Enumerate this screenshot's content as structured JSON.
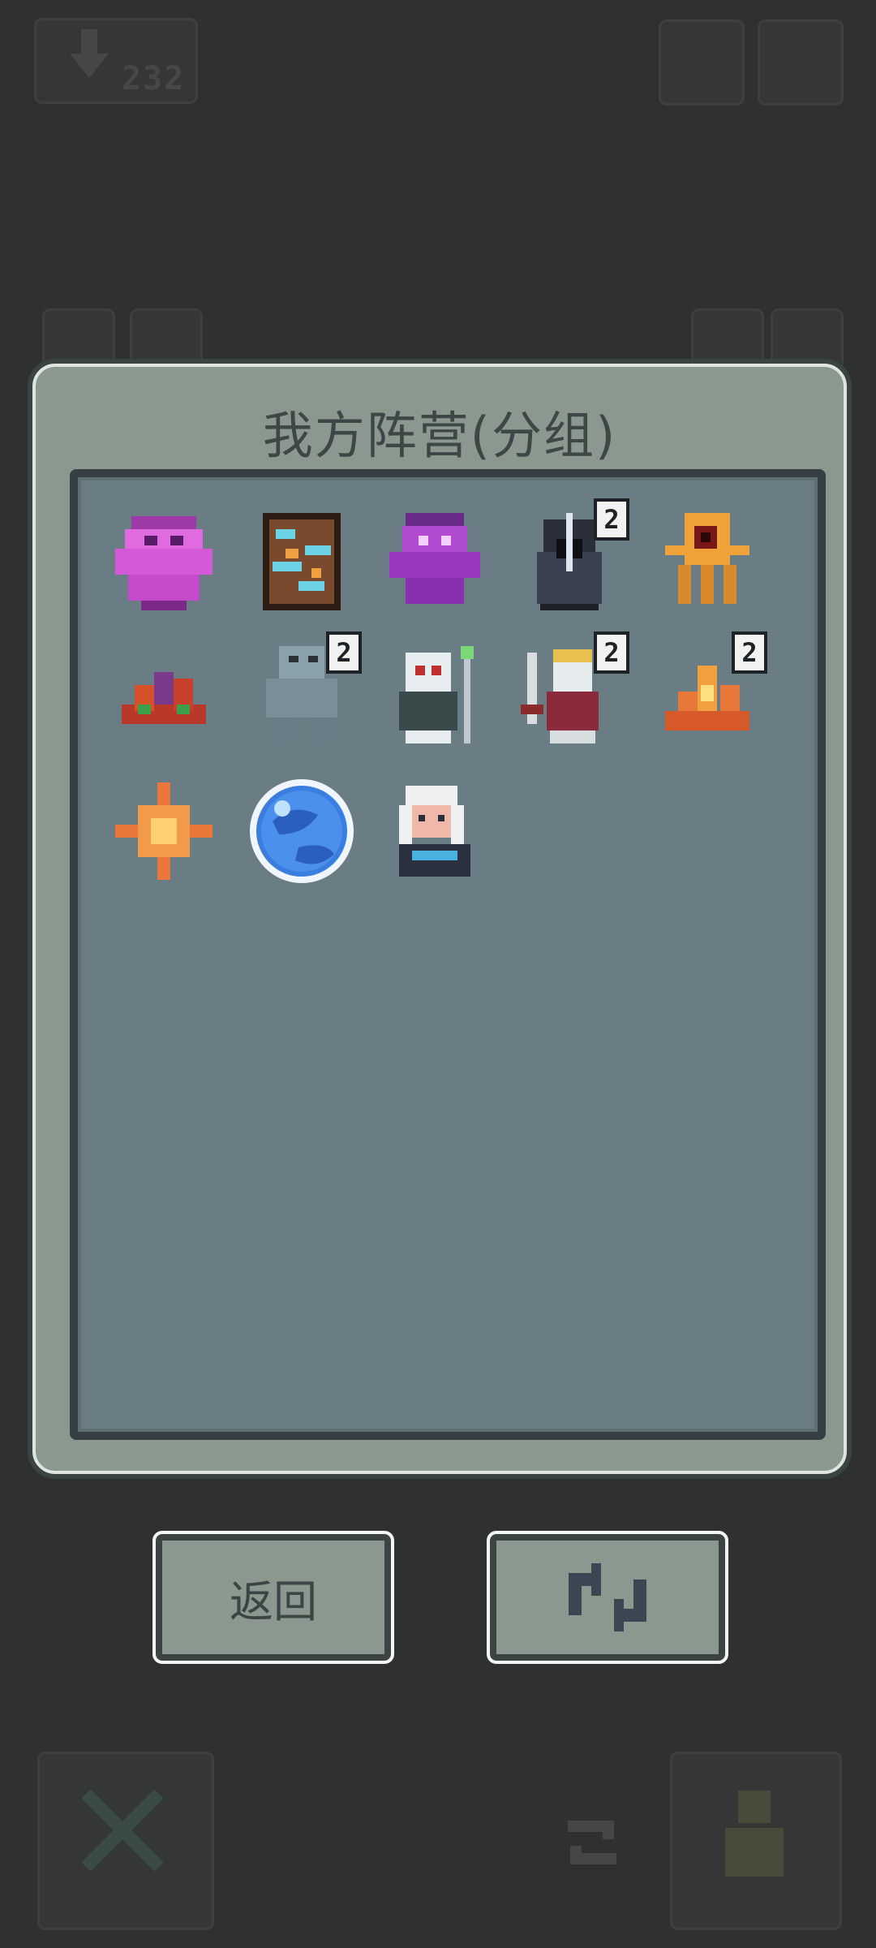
{
  "background": {
    "top_counter": "232"
  },
  "panel": {
    "title": "我方阵营(分组)",
    "units": [
      {
        "icon": "pink-demon-icon"
      },
      {
        "icon": "rock-golem-icon"
      },
      {
        "icon": "purple-demon-icon"
      },
      {
        "icon": "hooded-assassin-icon",
        "count": "2"
      },
      {
        "icon": "tentacle-eye-icon"
      },
      {
        "icon": "red-plant-icon"
      },
      {
        "icon": "stone-ghoul-icon",
        "count": "2"
      },
      {
        "icon": "skull-shaman-icon"
      },
      {
        "icon": "crowned-skeleton-icon",
        "count": "2"
      },
      {
        "icon": "flame-crystal-icon",
        "count": "2"
      },
      {
        "icon": "orange-star-icon"
      },
      {
        "icon": "blue-orb-icon"
      },
      {
        "icon": "white-haired-mage-icon"
      }
    ]
  },
  "buttons": {
    "back_label": "返回",
    "refresh_icon": "refresh-icon"
  },
  "colors": {
    "background": "#2f3030",
    "panel": "#8b9890",
    "inner": "#6b7d84",
    "border_dark": "#353f43"
  }
}
